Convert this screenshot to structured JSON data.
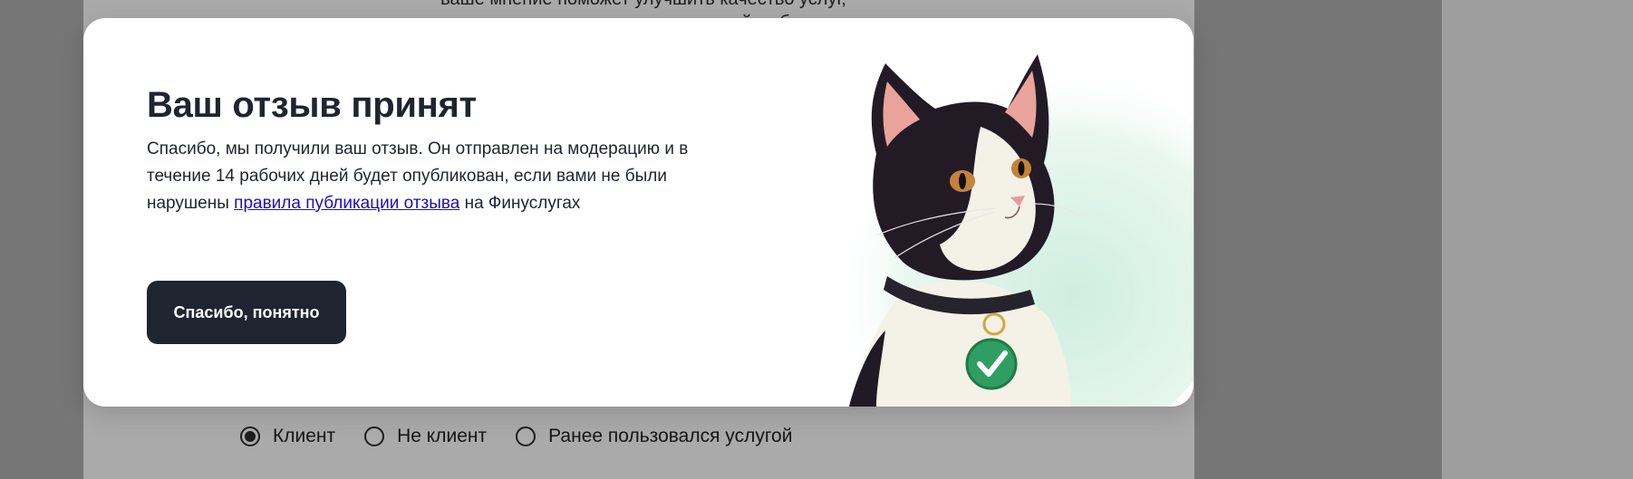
{
  "background": {
    "top_text_line1": "ваше мнение поможет улучшить качество услуг,",
    "top_text_line2": "а другим — сделать осознанный выбор",
    "client_options": [
      {
        "label": "Клиент",
        "selected": true
      },
      {
        "label": "Не клиент",
        "selected": false
      },
      {
        "label": "Ранее пользовался услугой",
        "selected": false
      }
    ]
  },
  "modal": {
    "title": "Ваш отзыв принят",
    "text_before_link": "Спасибо, мы получили ваш отзыв. Он отправлен на модерацию и в течение 14 рабочих дней будет опубликован, если вами не были нарушены ",
    "link_text": "правила публикации отзыва",
    "text_after_link": " на Финуслугах",
    "button_label": "Спасибо, понятно",
    "illustration": "cat-with-checkmark-tag"
  },
  "colors": {
    "button_bg": "#1f2430",
    "link": "#1a0dcc",
    "tag_green": "#2f9e62",
    "glow": "#cfeee0"
  }
}
